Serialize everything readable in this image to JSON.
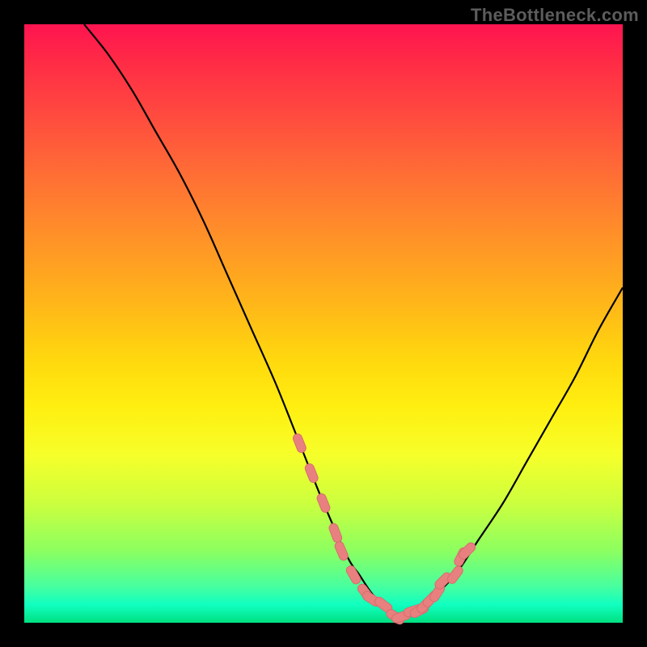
{
  "watermark": "TheBottleneck.com",
  "colors": {
    "background": "#000000",
    "curve": "#000000",
    "marker_fill": "#e98080",
    "marker_stroke": "#d66e6e"
  },
  "chart_data": {
    "type": "line",
    "title": "",
    "xlabel": "",
    "ylabel": "",
    "xlim": [
      0,
      100
    ],
    "ylim": [
      0,
      100
    ],
    "x": [
      10,
      14,
      18,
      22,
      26,
      30,
      34,
      38,
      42,
      46,
      50,
      54,
      56,
      58,
      60,
      62,
      64,
      66,
      68,
      72,
      76,
      80,
      84,
      88,
      92,
      96,
      100
    ],
    "values": [
      100,
      95,
      89,
      82,
      75,
      67,
      58,
      49,
      40,
      30,
      20,
      11,
      8,
      5,
      3,
      1,
      1,
      2,
      4,
      8,
      14,
      20,
      27,
      34,
      41,
      49,
      56
    ],
    "markers": {
      "note": "salmon capsule markers near the valley",
      "x": [
        46,
        48,
        50,
        52,
        53,
        55,
        57,
        58,
        60,
        62,
        63,
        65,
        66,
        67,
        68,
        69,
        70,
        72,
        73,
        74
      ],
      "y": [
        30,
        25,
        20,
        15,
        12,
        8,
        5,
        4,
        3,
        1,
        1,
        2,
        2,
        3,
        4,
        5,
        7,
        8,
        11,
        12
      ]
    }
  }
}
